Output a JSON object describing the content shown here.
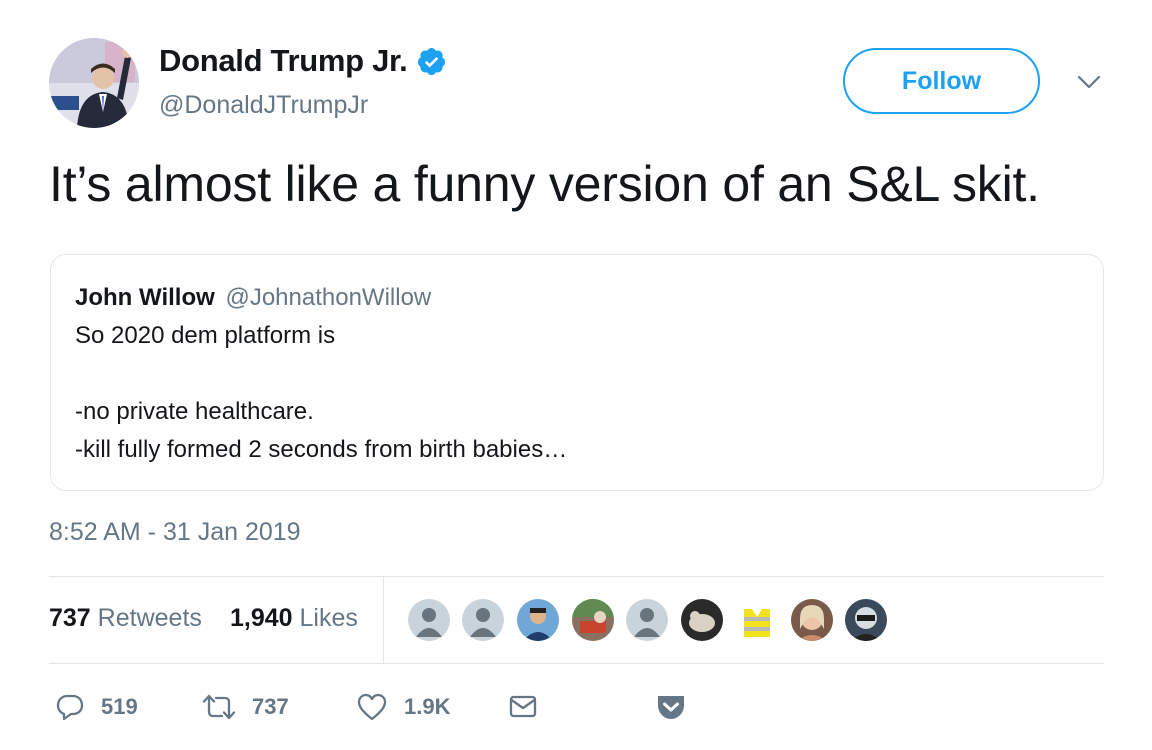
{
  "author": {
    "name": "Donald Trump Jr.",
    "handle": "@DonaldJTrumpJr",
    "verified": true,
    "avatar_icon": "profile-photo"
  },
  "follow_label": "Follow",
  "tweet_text": "It’s almost like a funny version of an S&L skit.",
  "quoted": {
    "name": "John Willow",
    "handle": "@JohnathonWillow",
    "lines": [
      "So 2020 dem platform is",
      "",
      "-no private healthcare.",
      "-kill fully formed 2 seconds from birth babies…"
    ]
  },
  "timestamp": "8:52 AM - 31 Jan 2019",
  "stats": {
    "retweets_count": "737",
    "retweets_label": "Retweets",
    "likes_count": "1,940",
    "likes_label": "Likes"
  },
  "likers": [
    "default-avatar",
    "default-avatar",
    "user-avatar",
    "user-avatar",
    "default-avatar",
    "user-avatar",
    "user-avatar",
    "user-avatar",
    "user-avatar"
  ],
  "actions": {
    "replies": "519",
    "retweets": "737",
    "likes": "1.9K"
  },
  "colors": {
    "accent": "#1da1f2",
    "text": "#14171a",
    "secondary": "#657786",
    "border": "#e1e8ed"
  }
}
